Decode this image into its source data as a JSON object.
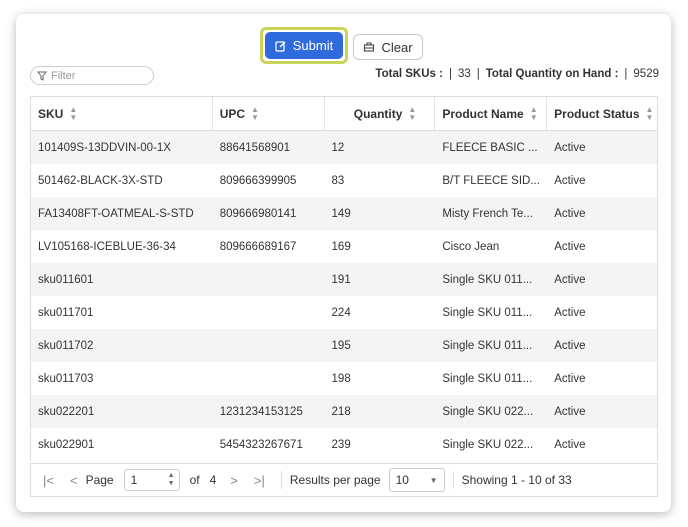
{
  "toolbar": {
    "submit_label": "Submit",
    "clear_label": "Clear"
  },
  "filter": {
    "placeholder": "Filter"
  },
  "totals": {
    "skus_label": "Total SKUs :",
    "skus_value": "33",
    "qty_label": "Total Quantity on Hand :",
    "qty_value": "9529"
  },
  "columns": [
    "SKU",
    "UPC",
    "Quantity",
    "Product Name",
    "Product Status"
  ],
  "rows": [
    {
      "sku": "101409S-13DDVIN-00-1X",
      "upc": "88641568901",
      "qty": "12",
      "name": "FLEECE BASIC ...",
      "status": "Active"
    },
    {
      "sku": "501462-BLACK-3X-STD",
      "upc": "809666399905",
      "qty": "83",
      "name": "B/T FLEECE SID...",
      "status": "Active"
    },
    {
      "sku": "FA13408FT-OATMEAL-S-STD",
      "upc": "809666980141",
      "qty": "149",
      "name": "Misty French Te...",
      "status": "Active"
    },
    {
      "sku": "LV105168-ICEBLUE-36-34",
      "upc": "809666689167",
      "qty": "169",
      "name": "Cisco Jean",
      "status": "Active"
    },
    {
      "sku": "sku011601",
      "upc": "",
      "qty": "191",
      "name": "Single SKU 011...",
      "status": "Active"
    },
    {
      "sku": "sku011701",
      "upc": "",
      "qty": "224",
      "name": "Single SKU 011...",
      "status": "Active"
    },
    {
      "sku": "sku011702",
      "upc": "",
      "qty": "195",
      "name": "Single SKU 011...",
      "status": "Active"
    },
    {
      "sku": "sku011703",
      "upc": "",
      "qty": "198",
      "name": "Single SKU 011...",
      "status": "Active"
    },
    {
      "sku": "sku022201",
      "upc": "1231234153125",
      "qty": "218",
      "name": "Single SKU 022...",
      "status": "Active"
    },
    {
      "sku": "sku022901",
      "upc": "5454323267671",
      "qty": "239",
      "name": "Single SKU 022...",
      "status": "Active"
    }
  ],
  "pager": {
    "page_label": "Page",
    "page_value": "1",
    "of_label": "of",
    "total_pages": "4",
    "per_page_label": "Results per page",
    "per_page_value": "10",
    "showing": "Showing 1 - 10 of 33"
  },
  "colors": {
    "accent": "#2f6bdc",
    "highlight": "#c9d45a"
  }
}
